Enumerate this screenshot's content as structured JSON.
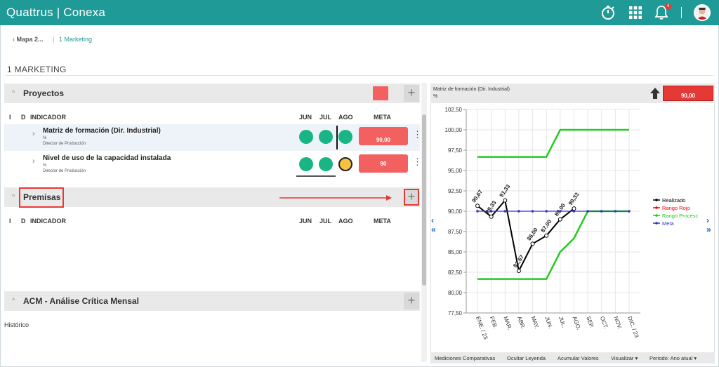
{
  "app": {
    "brand": "Quattrus | Conexa",
    "notification_count": "4"
  },
  "breadcrumb": {
    "back": "Mapa 2...",
    "current": "1 Marketing"
  },
  "page": {
    "title": "1 MARKETING",
    "history": "Histórico"
  },
  "columns": {
    "i": "I",
    "d": "D",
    "indicator": "INDICADOR",
    "jun": "JUN",
    "jul": "JUL",
    "ago": "AGO",
    "meta": "META"
  },
  "sections": {
    "proyectos": {
      "label": "Proyectos",
      "status_color": "#f26060"
    },
    "premisas": {
      "label": "Premisas"
    },
    "acm": {
      "label": "ACM - Análise Crítica Mensal"
    }
  },
  "indicators": [
    {
      "name": "Matriz de formación (Dir. Industrial)",
      "unit": "%",
      "owner": "Director de Producción",
      "meta": "90,00",
      "months": [
        "green",
        "green",
        "green"
      ]
    },
    {
      "name": "Nivel de uso de la capacidad instalada",
      "unit": "%",
      "owner": "Director de Producción",
      "meta": "90",
      "months": [
        "green",
        "green",
        "yellow"
      ]
    }
  ],
  "chart_header": {
    "title": "Matriz de formación (Dir. Industrial)",
    "unit": "%",
    "value": "90,00"
  },
  "chart_footer": {
    "comparative": "Mediciones Comparativas",
    "hide_legend": "Ocultar Leyenda",
    "accumulate": "Acumular Valores",
    "visualize": "Visualizar ▾",
    "period": "Periodo: Ano atual ▾"
  },
  "chart_data": {
    "type": "line",
    "categories": [
      "ENE. / 23",
      "FEB.",
      "MAR.",
      "ABR.",
      "MAY.",
      "JUN.",
      "JUL.",
      "AGO.",
      "SEP.",
      "OCT.",
      "NOV.",
      "DIC. / 23"
    ],
    "ylim": [
      77.5,
      102.5
    ],
    "y_ticks": [
      "77,50",
      "80,00",
      "82,50",
      "85,00",
      "87,50",
      "90,00",
      "92,50",
      "95,00",
      "97,50",
      "100,00",
      "102,50"
    ],
    "grid": true,
    "legend_position": "right",
    "series": [
      {
        "name": "Realizado",
        "color": "#000000",
        "values": [
          90.67,
          89.33,
          91.33,
          82.67,
          86.0,
          87.0,
          89.0,
          90.33,
          null,
          null,
          null,
          null
        ],
        "labels": [
          "90,67",
          "89,33",
          "91,33",
          "82,67",
          "86,00",
          "87,00",
          "89,00",
          "90,33"
        ]
      },
      {
        "name": "Rango Rojo",
        "color": "#ff0000",
        "values": []
      },
      {
        "name": "Rango Procesc",
        "color": "#22cc22",
        "values": [
          81.67,
          81.67,
          81.67,
          81.67,
          81.67,
          81.67,
          85.0,
          86.67,
          90.0,
          90.0,
          90.0,
          90.0
        ]
      },
      {
        "name": "Rango Procesc",
        "color": "#22cc22",
        "values": [
          96.67,
          96.67,
          96.67,
          96.67,
          96.67,
          96.67,
          100.0,
          100.0,
          100.0,
          100.0,
          100.0,
          100.0
        ],
        "legend": false
      },
      {
        "name": "Meta",
        "color": "#3333cc",
        "values": [
          90,
          90,
          90,
          90,
          90,
          90,
          90,
          90,
          90,
          90,
          90,
          90
        ]
      }
    ]
  }
}
